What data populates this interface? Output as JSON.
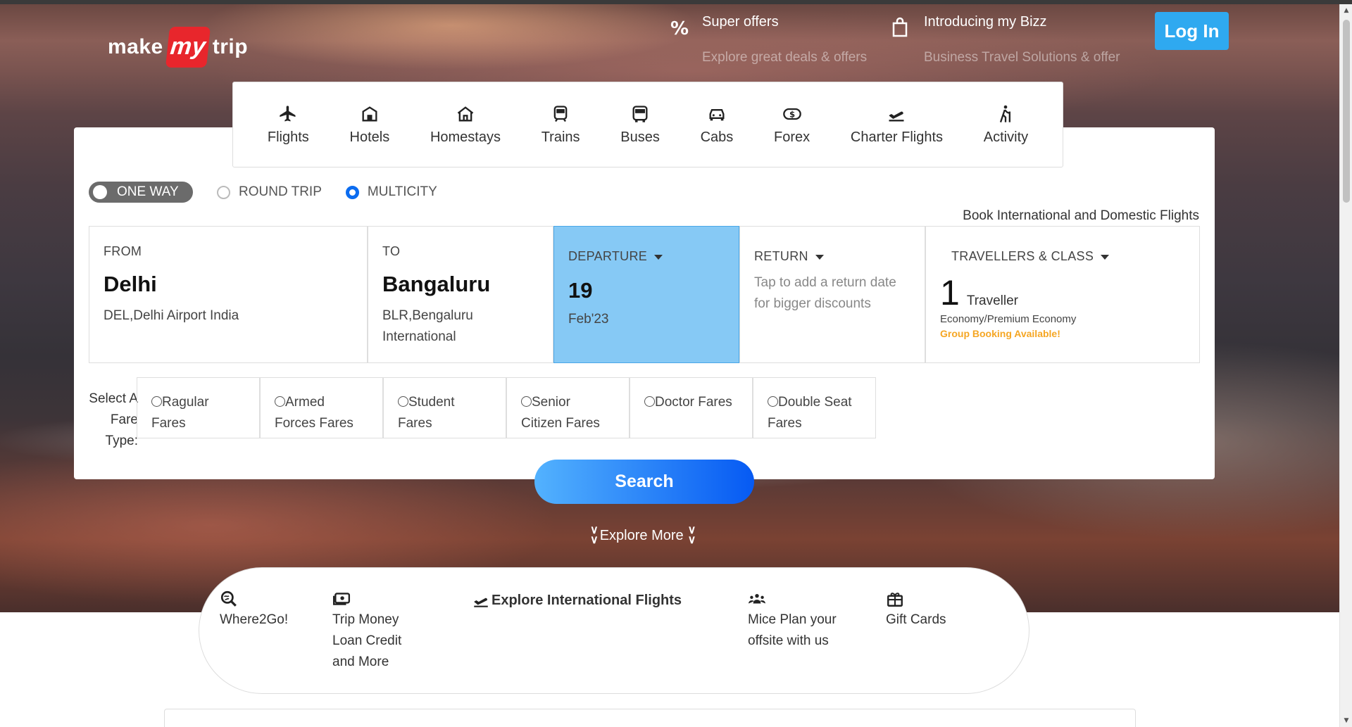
{
  "header": {
    "logo": {
      "make": "make",
      "my": "my",
      "trip": "trip"
    },
    "offers": {
      "title": "Super offers",
      "subtitle": "Explore great deals & offers",
      "icon": "percent-icon"
    },
    "bizz": {
      "title": "Introducing my Bizz",
      "subtitle": "Business Travel Solutions & offer",
      "icon": "shopping-bag-icon"
    },
    "login_label": "Log In"
  },
  "nav": {
    "tabs": [
      {
        "label": "Flights",
        "icon": "plane-icon"
      },
      {
        "label": "Hotels",
        "icon": "hotel-icon"
      },
      {
        "label": "Homestays",
        "icon": "home-icon"
      },
      {
        "label": "Trains",
        "icon": "train-icon"
      },
      {
        "label": "Buses",
        "icon": "bus-icon"
      },
      {
        "label": "Cabs",
        "icon": "car-icon"
      },
      {
        "label": "Forex",
        "icon": "money-icon"
      },
      {
        "label": "Charter Flights",
        "icon": "plane-departure-icon"
      },
      {
        "label": "Activity",
        "icon": "hiking-icon"
      }
    ]
  },
  "trip_types": {
    "one_way": "ONE WAY",
    "round_trip": "ROUND TRIP",
    "multicity": "MULTICITY",
    "selected": "MULTICITY"
  },
  "book_note": "Book International and Domestic Flights",
  "fields": {
    "from": {
      "label": "FROM",
      "city": "Delhi",
      "detail": "DEL,Delhi Airport India"
    },
    "to": {
      "label": "TO",
      "city": "Bangaluru",
      "detail": "BLR,Bengaluru International"
    },
    "departure": {
      "label": "DEPARTURE",
      "day": "19",
      "month": "Feb'23"
    },
    "return": {
      "label": "RETURN",
      "hint": "Tap to add a return date for bigger discounts"
    },
    "travellers": {
      "label": "TRAVELLERS & CLASS",
      "count": "1",
      "unit": "Traveller",
      "class": "Economy/Premium Economy",
      "group": "Group Booking Available!"
    }
  },
  "fare_types": {
    "label": "Select A Fare Type:",
    "options": [
      "Ragular Fares",
      "Armed Forces Fares",
      "Student Fares",
      "Senior Citizen Fares",
      "Doctor Fares",
      "Double Seat Fares"
    ]
  },
  "search_label": "Search",
  "explore_label": "Explore More",
  "explore_items": {
    "where2go": "Where2Go!",
    "trip_money": "Trip Money Loan Credit and More",
    "intl": "Explore International Flights",
    "mice": "Mice Plan your offsite with us",
    "gift": "Gift Cards"
  },
  "colors": {
    "accent": "#2fa9f0",
    "brand_red": "#e8262c",
    "departure_bg": "#86c9f5",
    "radio_selected": "#0b6cf0",
    "group_booking": "#f5a623"
  }
}
